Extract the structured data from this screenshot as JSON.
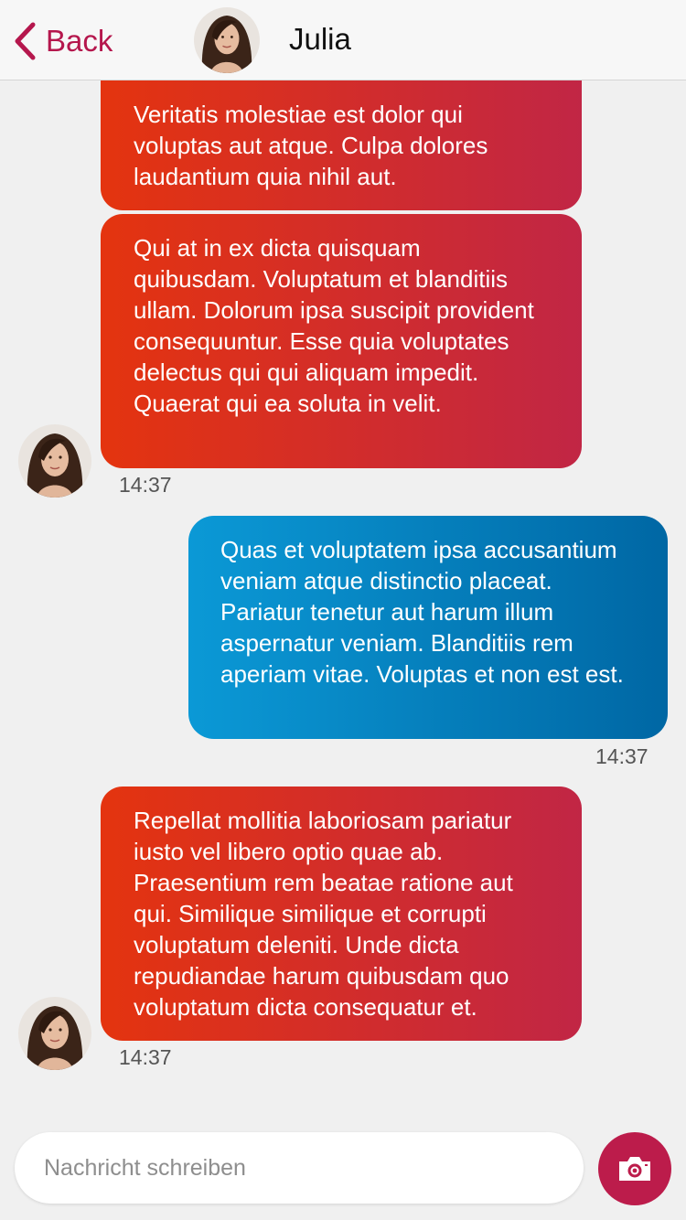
{
  "header": {
    "back_label": "Back",
    "contact_name": "Julia"
  },
  "messages": [
    {
      "direction": "incoming",
      "text": "Veritatis molestiae est dolor qui voluptas aut atque. Culpa dolores laudantium quia nihil aut."
    },
    {
      "direction": "incoming",
      "text": "Qui at in ex dicta quisquam quibusdam. Voluptatum et blanditiis ullam. Dolorum ipsa suscipit provident consequuntur. Esse quia voluptates delectus qui qui aliquam impedit. Quaerat qui ea soluta in velit.",
      "time": "14:37"
    },
    {
      "direction": "outgoing",
      "text": "Quas et voluptatem ipsa accusantium veniam atque distinctio placeat. Pariatur tenetur aut harum illum aspernatur veniam. Blanditiis rem aperiam vitae. Voluptas et non est est.",
      "time": "14:37"
    },
    {
      "direction": "incoming",
      "text": "Repellat mollitia laboriosam pariatur iusto vel libero optio quae ab. Praesentium rem beatae ratione aut qui. Similique similique et corrupti voluptatum deleniti. Unde dicta repudiandae harum quibusdam quo voluptatum dicta consequatur et.",
      "time": "14:37"
    }
  ],
  "composer": {
    "placeholder": "Nachricht schreiben",
    "value": ""
  },
  "icons": {
    "back": "chevron-left-icon",
    "send_photo": "camera-icon"
  },
  "colors": {
    "accent": "#b5174d",
    "incoming_start": "#e4340f",
    "incoming_end": "#c12645",
    "outgoing_start": "#0b99d6",
    "outgoing_end": "#0067a4",
    "camera_button": "#bc1c4b"
  }
}
